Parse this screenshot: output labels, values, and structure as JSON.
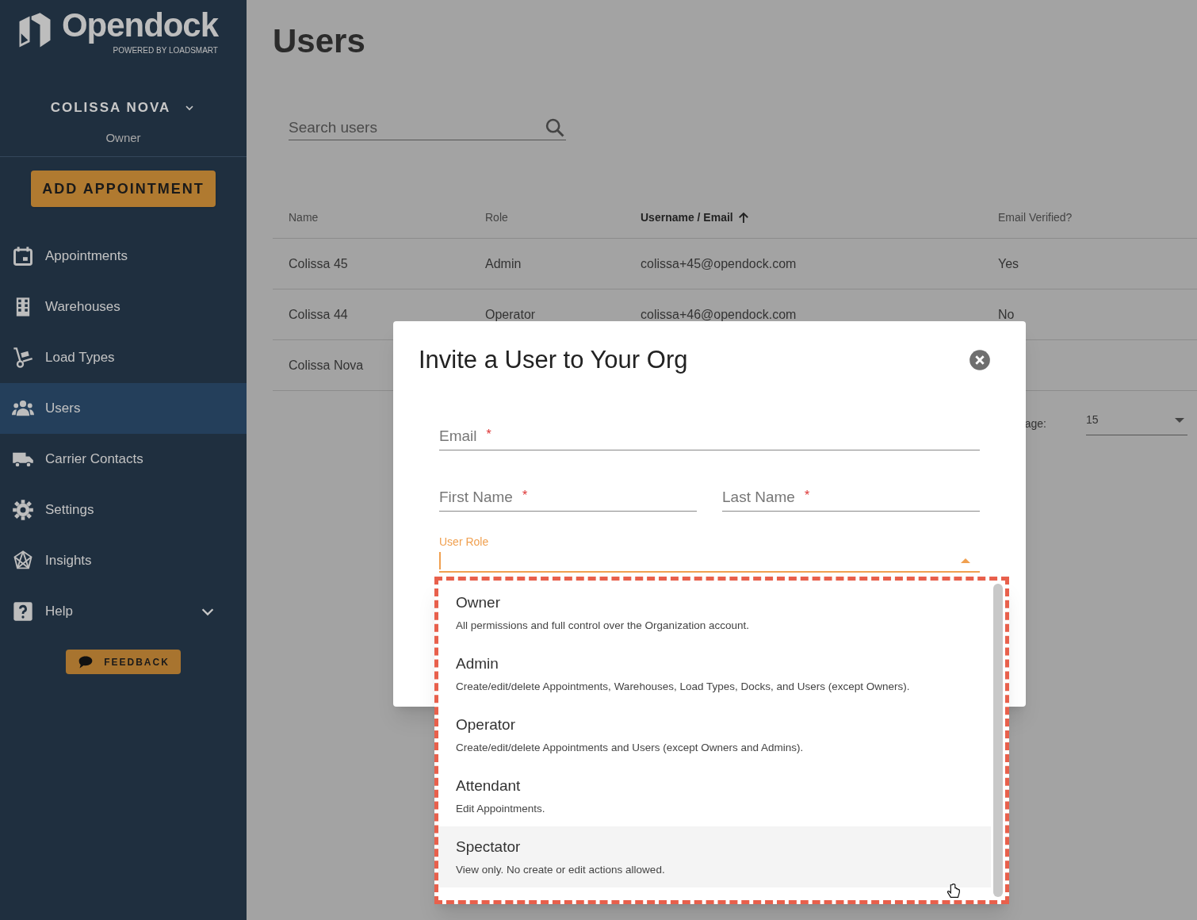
{
  "sidebar": {
    "logo": {
      "name": "Opendock",
      "tagline": "POWERED BY LOADSMART"
    },
    "org": {
      "name": "COLISSA NOVA",
      "role": "Owner"
    },
    "add_button": "ADD APPOINTMENT",
    "items": [
      {
        "label": "Appointments",
        "selected": false
      },
      {
        "label": "Warehouses",
        "selected": false
      },
      {
        "label": "Load Types",
        "selected": false
      },
      {
        "label": "Users",
        "selected": true
      },
      {
        "label": "Carrier Contacts",
        "selected": false
      },
      {
        "label": "Settings",
        "selected": false
      },
      {
        "label": "Insights",
        "selected": false
      },
      {
        "label": "Help",
        "selected": false,
        "expanded": false
      }
    ],
    "feedback_button": "FEEDBACK"
  },
  "page": {
    "title": "Users",
    "search": {
      "placeholder": "Search users"
    },
    "table": {
      "columns": [
        {
          "label": "Name",
          "sorted": false
        },
        {
          "label": "Role",
          "sorted": false
        },
        {
          "label": "Username / Email",
          "sorted": true
        },
        {
          "label": "Email Verified?",
          "sorted": false
        }
      ],
      "rows": [
        [
          "Colissa 45",
          "Admin",
          "colissa+45@opendock.com",
          "Yes"
        ],
        [
          "Colissa 44",
          "Operator",
          "colissa+46@opendock.com",
          "No"
        ],
        [
          "Colissa Nova"
        ]
      ]
    },
    "pagination": {
      "label": "age:",
      "per_page": "15"
    }
  },
  "dialog": {
    "title": "Invite a User to Your Org",
    "fields": [
      {
        "label": "Email",
        "required_mark": "*"
      },
      {
        "label": "First Name",
        "required_mark": "*"
      },
      {
        "label": "Last Name",
        "required_mark": "*"
      }
    ],
    "role_select": {
      "label": "User Role",
      "expanded": true
    },
    "options": [
      {
        "title": "Owner",
        "description": "All permissions and full control over the Organization account.",
        "hovered": false
      },
      {
        "title": "Admin",
        "description": "Create/edit/delete Appointments, Warehouses, Load Types, Docks, and Users (except Owners).",
        "hovered": false
      },
      {
        "title": "Operator",
        "description": "Create/edit/delete Appointments and Users (except Owners and Admins).",
        "hovered": false
      },
      {
        "title": "Attendant",
        "description": "Edit Appointments.",
        "hovered": false
      },
      {
        "title": "Spectator",
        "description": "View only. No create or edit actions allowed.",
        "hovered": true
      }
    ]
  }
}
